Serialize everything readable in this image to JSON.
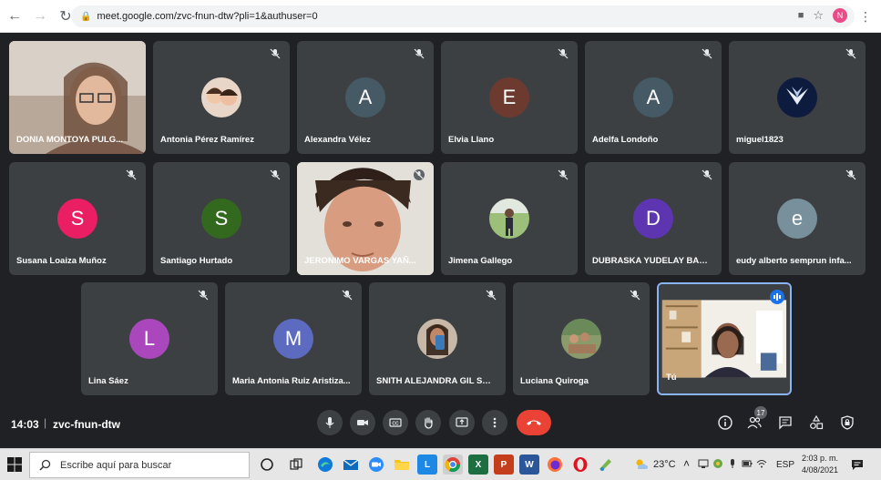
{
  "browser": {
    "url": "meet.google.com/zvc-fnun-dtw?pli=1&authuser=0",
    "profile_initial": "N"
  },
  "participants": [
    {
      "name": "DONIA MONTOYA PULG...",
      "type": "video"
    },
    {
      "name": "Antonia Pérez Ramírez",
      "type": "photo"
    },
    {
      "name": "Alexandra Vélez",
      "type": "initial",
      "initial": "A",
      "color": "#455a64"
    },
    {
      "name": "Elvia Llano",
      "type": "initial",
      "initial": "E",
      "color": "#6d3a2f"
    },
    {
      "name": "Adelfa Londoño",
      "type": "initial",
      "initial": "A",
      "color": "#455a64"
    },
    {
      "name": "miguel1823",
      "type": "photo"
    },
    {
      "name": "Susana Loaiza Muñoz",
      "type": "initial",
      "initial": "S",
      "color": "#e91e63"
    },
    {
      "name": "Santiago Hurtado",
      "type": "initial",
      "initial": "S",
      "color": "#33691e"
    },
    {
      "name": "JERONIMO VARGAS YAÑ...",
      "type": "video"
    },
    {
      "name": "Jimena Gallego",
      "type": "photo"
    },
    {
      "name": "DUBRASKA YUDELAY BAU...",
      "type": "initial",
      "initial": "D",
      "color": "#5e35b1"
    },
    {
      "name": "eudy alberto semprun infa...",
      "type": "initial",
      "initial": "e",
      "color": "#78909c"
    },
    {
      "name": "Lina Sáez",
      "type": "initial",
      "initial": "L",
      "color": "#ab47bc"
    },
    {
      "name": "Maria Antonia Ruiz Aristiza...",
      "type": "initial",
      "initial": "M",
      "color": "#5c6bc0"
    },
    {
      "name": "SNITH ALEJANDRA GIL SE...",
      "type": "photo"
    },
    {
      "name": "Luciana Quiroga",
      "type": "photo"
    },
    {
      "name": "Tú",
      "type": "video"
    }
  ],
  "meeting": {
    "time": "14:03",
    "code": "zvc-fnun-dtw",
    "participant_count": "17"
  },
  "taskbar": {
    "search_placeholder": "Escribe aquí para buscar",
    "weather": "23°C",
    "language": "ESP",
    "time": "2:03 p. m.",
    "date": "4/08/2021"
  }
}
